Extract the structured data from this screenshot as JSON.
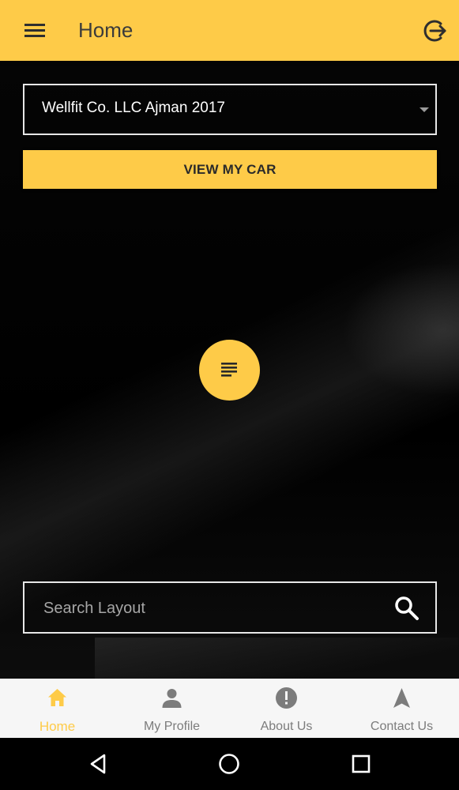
{
  "header": {
    "title": "Home",
    "menu_icon": "hamburger-menu-icon",
    "logout_icon": "logout-icon"
  },
  "selector": {
    "selected_value": "Wellfit Co. LLC Ajman 2017"
  },
  "view_button": {
    "label": "VIEW MY CAR"
  },
  "fab": {
    "icon": "list-text-icon"
  },
  "search": {
    "placeholder": "Search Layout",
    "value": "",
    "icon": "search-icon"
  },
  "bottom_nav": {
    "items": [
      {
        "label": "Home",
        "icon": "home-icon",
        "active": true
      },
      {
        "label": "My Profile",
        "icon": "person-icon",
        "active": false
      },
      {
        "label": "About Us",
        "icon": "info-alert-icon",
        "active": false
      },
      {
        "label": "Contact Us",
        "icon": "navigation-arrow-icon",
        "active": false
      }
    ]
  },
  "system_nav": {
    "back_icon": "back-triangle-icon",
    "home_icon": "home-circle-icon",
    "recents_icon": "recents-square-icon"
  },
  "colors": {
    "accent": "#fecb48",
    "background": "#000000",
    "header_text": "#3b3b3b",
    "nav_inactive": "#7c7c7c",
    "nav_background": "#f6f6f6"
  }
}
